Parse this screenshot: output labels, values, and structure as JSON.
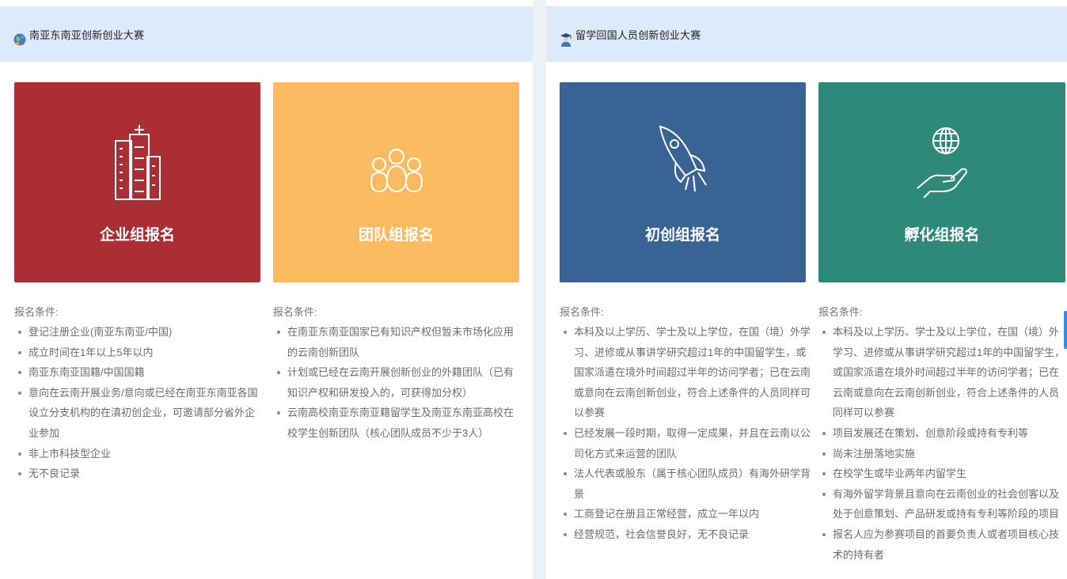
{
  "left_section": {
    "title": "南亚东南亚创新创业大赛",
    "icon": "globe-people-icon",
    "cards": [
      {
        "label": "企业组报名",
        "icon": "buildings-icon",
        "color": "#ab2e35"
      },
      {
        "label": "团队组报名",
        "icon": "team-icon",
        "color": "#fdbb61"
      }
    ],
    "conditions": [
      {
        "title": "报名条件:",
        "items": [
          "登记注册企业(南亚东南亚/中国)",
          "成立时间在1年以上5年以内",
          "南亚东南亚国籍/中国国籍",
          "意向在云南开展业务/意向或已经在南亚东南亚各国设立分支机构的在滇初创企业，可邀请部分省外企业参加",
          "非上市科技型企业",
          "无不良记录"
        ]
      },
      {
        "title": "报名条件:",
        "items": [
          "在南亚东南亚国家已有知识产权但暂未市场化应用的云南创新团队",
          "计划或已经在云南开展创新创业的外籍团队（已有知识产权和研发投入的，可获得加分权）",
          "云南高校南亚东南亚籍留学生及南亚东南亚高校在校学生创新团队（核心团队成员不少于3人）"
        ]
      }
    ]
  },
  "right_section": {
    "title": "留学回国人员创新创业大赛",
    "icon": "graduate-icon",
    "cards": [
      {
        "label": "初创组报名",
        "icon": "rocket-icon",
        "color": "#396392"
      },
      {
        "label": "孵化组报名",
        "icon": "hand-globe-icon",
        "color": "#2f8979"
      }
    ],
    "conditions": [
      {
        "title": "报名条件:",
        "items": [
          "本科及以上学历、学士及以上学位，在国（境）外学习、进修或从事讲学研究超过1年的中国留学生，或国家派遣在境外时间超过半年的访问学者；已在云南或意向在云南创新创业，符合上述条件的人员同样可以参赛",
          "已经发展一段时期，取得一定成果，并且在云南以公司化方式来运营的团队",
          "法人代表或股东（属于核心团队成员）有海外研学背景",
          "工商登记在册且正常经营，成立一年以内",
          "经营规范，社会信誉良好，无不良记录"
        ]
      },
      {
        "title": "报名条件:",
        "items": [
          "本科及以上学历、学士及以上学位，在国（境）外学习、进修或从事讲学研究超过1年的中国留学生，或国家派遣在境外时间超过半年的访问学者；已在云南或意向在云南创新创业，符合上述条件的人员同样可以参赛",
          "项目发展还在策划、创意阶段或持有专利等",
          "尚未注册落地实施",
          "在校学生或毕业两年内留学生",
          "有海外留学背景且意向在云南创业的社会创客以及处于创意策划、产品研发或持有专利等阶段的项目",
          "报名人应为参赛项目的首要负责人或者项目核心技术的持有者"
        ]
      }
    ]
  }
}
